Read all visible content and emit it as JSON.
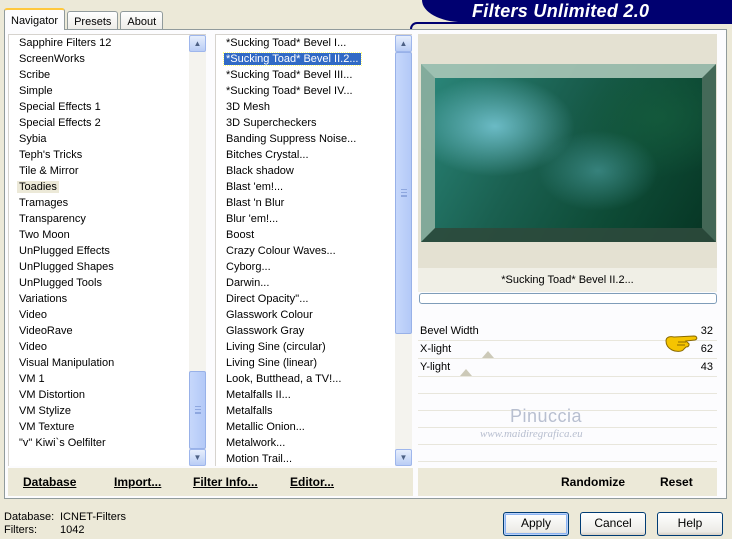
{
  "tabs": [
    {
      "label": "Navigator",
      "active": true
    },
    {
      "label": "Presets",
      "active": false
    },
    {
      "label": "About",
      "active": false
    }
  ],
  "banner": {
    "title": "Filters Unlimited 2.0",
    "color": "#000070"
  },
  "categories": {
    "items": [
      "Sapphire Filters 12",
      "ScreenWorks",
      "Scribe",
      "Simple",
      "Special Effects 1",
      "Special Effects 2",
      "Sybia",
      "Teph's Tricks",
      "Tile & Mirror",
      "Toadies",
      "Tramages",
      "Transparency",
      "Two Moon",
      "UnPlugged Effects",
      "UnPlugged Shapes",
      "UnPlugged Tools",
      "Variations",
      "Video",
      "VideoRave",
      "Video",
      "Visual Manipulation",
      "VM 1",
      "VM Distortion",
      "VM Stylize",
      "VM Texture",
      "\"v\" Kiwi`s Oelfilter"
    ],
    "selected": "Toadies"
  },
  "filters": {
    "items": [
      "*Sucking Toad*  Bevel I...",
      "*Sucking Toad*  Bevel II.2...",
      "*Sucking Toad*  Bevel III...",
      "*Sucking Toad*  Bevel IV...",
      "3D Mesh",
      "3D Supercheckers",
      "Banding Suppress Noise...",
      "Bitches Crystal...",
      "Black shadow",
      "Blast 'em!...",
      "Blast 'n Blur",
      "Blur 'em!...",
      "Boost",
      "Crazy Colour Waves...",
      "Cyborg...",
      "Darwin...",
      "Direct Opacity''...",
      "Glasswork Colour",
      "Glasswork Gray",
      "Living Sine (circular)",
      "Living Sine (linear)",
      "Look, Butthead, a TV!...",
      "Metalfalls II...",
      "Metalfalls",
      "Metallic Onion...",
      "Metalwork...",
      "Motion Trail..."
    ],
    "selected": "*Sucking Toad*  Bevel II.2..."
  },
  "preview": {
    "filter_name": "*Sucking Toad*  Bevel II.2...",
    "progress": 0
  },
  "params": [
    {
      "label": "Bevel Width",
      "value": "32"
    },
    {
      "label": "X-light",
      "value": "62"
    },
    {
      "label": "Y-light",
      "value": "43"
    }
  ],
  "watermark": {
    "name": "Pinuccia",
    "site": "www.maidiregrafica.eu"
  },
  "links": {
    "database": "Database",
    "import": "Import...",
    "filter_info": "Filter Info...",
    "editor": "Editor...",
    "randomize": "Randomize",
    "reset": "Reset"
  },
  "status": {
    "database_label": "Database:",
    "database_value": "ICNET-Filters",
    "filters_label": "Filters:",
    "filters_value": "1042"
  },
  "buttons": {
    "apply": "Apply",
    "cancel": "Cancel",
    "help": "Help"
  }
}
